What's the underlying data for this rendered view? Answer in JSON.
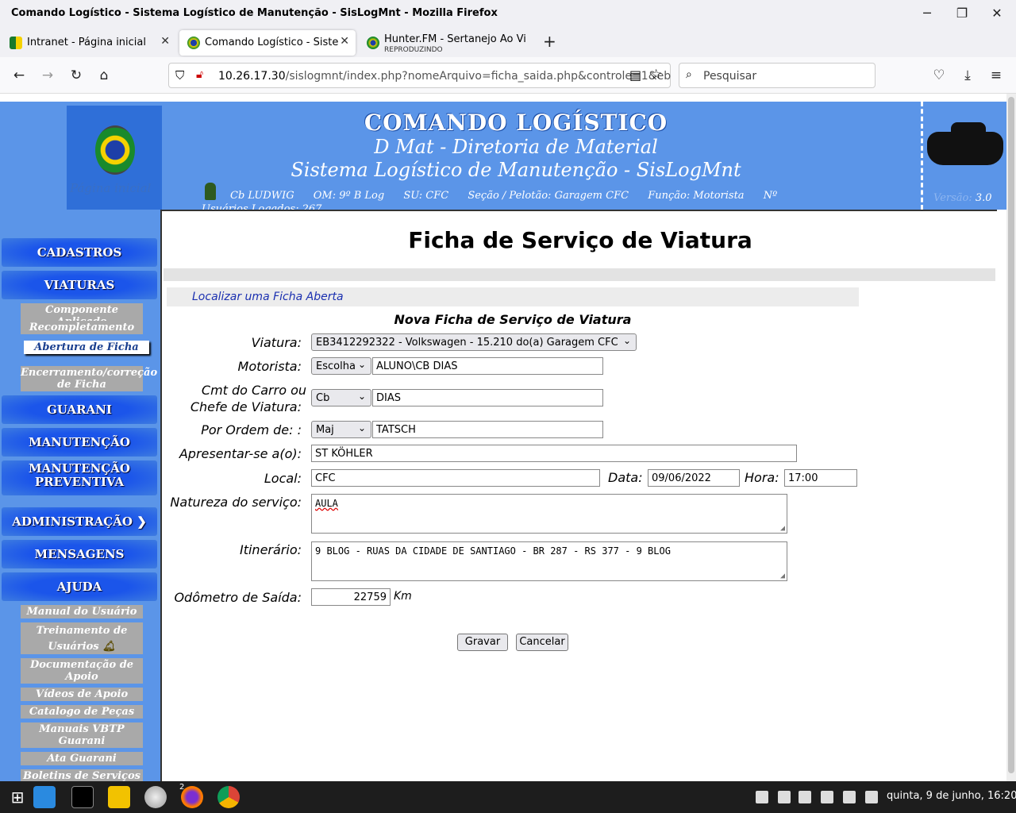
{
  "window": {
    "title": "Comando Logístico - Sistema Logístico de Manutenção - SisLogMnt - Mozilla Firefox",
    "minimize": "─",
    "maximize": "❐",
    "close": "✕"
  },
  "tabs": [
    {
      "label": "Intranet - Página inicial",
      "close": "✕"
    },
    {
      "label": "Comando Logístico - Sistem",
      "close": "✕"
    },
    {
      "label": "Hunter.FM - Sertanejo Ao Vi",
      "sub": "REPRODUZINDO"
    }
  ],
  "newtab": "+",
  "nav": {
    "back": "←",
    "forward": "→",
    "reload": "↻",
    "home": "⌂",
    "url_host": "10.26.17.30",
    "url_path": "/sislogmnt/index.php?nomeArquivo=ficha_saida.php&controle=1&eb",
    "search_placeholder": "Pesquisar",
    "reader": "▤",
    "bookmark": "☆",
    "pocket": "♡",
    "download": "⤓",
    "menu": "≡"
  },
  "header": {
    "home_link": "Página inicial",
    "title": "COMANDO LOGÍSTICO",
    "subtitle1": "D Mat - Diretoria de Material",
    "subtitle2": "Sistema Logístico de Manutenção - SisLogMnt",
    "user": "Cb LUDWIG",
    "om": "OM: 9º B Log",
    "su": "SU: CFC",
    "secao": "Seção / Pelotão: Garagem CFC",
    "funcao": "Função: Motorista",
    "numero": "Nº",
    "logados": "Usuários Logados: 267",
    "versao_label": "Versão:",
    "versao_value": "3.0"
  },
  "sidebar": {
    "cadastros": "CADASTROS",
    "viaturas": "VIATURAS",
    "viaturas_items": [
      "Componente Aplicado",
      "Recompletamento",
      "Abertura de Ficha",
      "Encerramento/correção de Ficha"
    ],
    "guarani": "GUARANI",
    "manutencao": "MANUTENÇÃO",
    "manutencao_preventiva": "MANUTENÇÃO PREVENTIVA",
    "administracao": "ADMINISTRAÇÃO",
    "mensagens": "MENSAGENS",
    "ajuda": "AJUDA",
    "ajuda_items": [
      "Manual do Usuário",
      "Treinamento de Usuários",
      "Documentação de Apoio",
      "Vídeos de Apoio",
      "Catalogo de Peças",
      "Manuais VBTP Guarani",
      "Ata Guarani",
      "Boletins de Serviços"
    ]
  },
  "form": {
    "page_title": "Ficha de Serviço de Viatura",
    "localizar": "Localizar uma Ficha Aberta",
    "section_title": "Nova Ficha de Serviço de Viatura",
    "viatura_label": "Viatura:",
    "viatura_value": "EB3412292322 - Volkswagen - 15.210 do(a) Garagem CFC",
    "motorista_label": "Motorista:",
    "motorista_select": "Escolha",
    "motorista_value": "ALUNO\\CB DIAS",
    "cmt_label_1": "Cmt do Carro ou",
    "cmt_label_2": "Chefe de Viatura:",
    "cmt_select": "Cb",
    "cmt_value": "DIAS",
    "ordem_label": "Por Ordem de:  :",
    "ordem_select": "Maj",
    "ordem_value": "TATSCH",
    "apresentar_label": "Apresentar-se a(o):",
    "apresentar_value": "ST KÖHLER",
    "local_label": "Local:",
    "local_value": "CFC",
    "data_label": "Data:",
    "data_value": "09/06/2022",
    "hora_label": "Hora:",
    "hora_value": "17:00",
    "natureza_label": "Natureza do serviço:",
    "natureza_value": "AULA",
    "itinerario_label": "Itinerário:",
    "itinerario_value": "9 BLOG - RUAS DA CIDADE DE SANTIAGO - BR 287 - RS 377 - 9 BLOG",
    "odometro_label": "Odômetro de Saída:",
    "odometro_value": "22759",
    "odometro_unit": "Km",
    "gravar": "Gravar",
    "cancelar": "Cancelar"
  },
  "taskbar": {
    "clock": "quinta, 9 de junho, 16:20",
    "firefox_badge": "2"
  }
}
